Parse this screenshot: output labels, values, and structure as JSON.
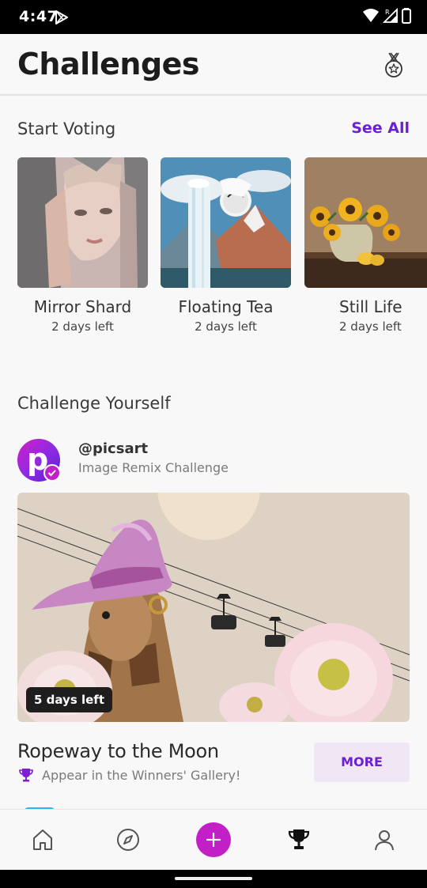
{
  "status_bar": {
    "time": "4:47",
    "network_indicator": "R",
    "icons": [
      "play-store-icon",
      "wifi-icon",
      "signal-icon",
      "battery-icon"
    ]
  },
  "header": {
    "title": "Challenges",
    "action_icon": "medal-icon"
  },
  "voting": {
    "section_title": "Start Voting",
    "see_all": "See All",
    "items": [
      {
        "name": "Mirror Shard",
        "time_left": "2 days left"
      },
      {
        "name": "Floating Tea",
        "time_left": "2 days left"
      },
      {
        "name": "Still Life",
        "time_left": "2 days left"
      }
    ]
  },
  "challenge_yourself": {
    "section_title": "Challenge Yourself",
    "author": "@picsart",
    "author_initial": "p",
    "subtitle": "Image Remix Challenge",
    "badge": "5 days left",
    "challenge_name": "Ropeway to the Moon",
    "reward_text": "Appear in the Winners' Gallery!",
    "more_button": "MORE"
  },
  "bottom_nav": {
    "items": [
      "home-icon",
      "explore-icon",
      "create-icon",
      "trophy-icon",
      "profile-icon"
    ],
    "active": "trophy-icon"
  },
  "colors": {
    "accent": "#6c1fd4",
    "create": "#c21fc6",
    "more_bg": "#f1e6f4"
  }
}
